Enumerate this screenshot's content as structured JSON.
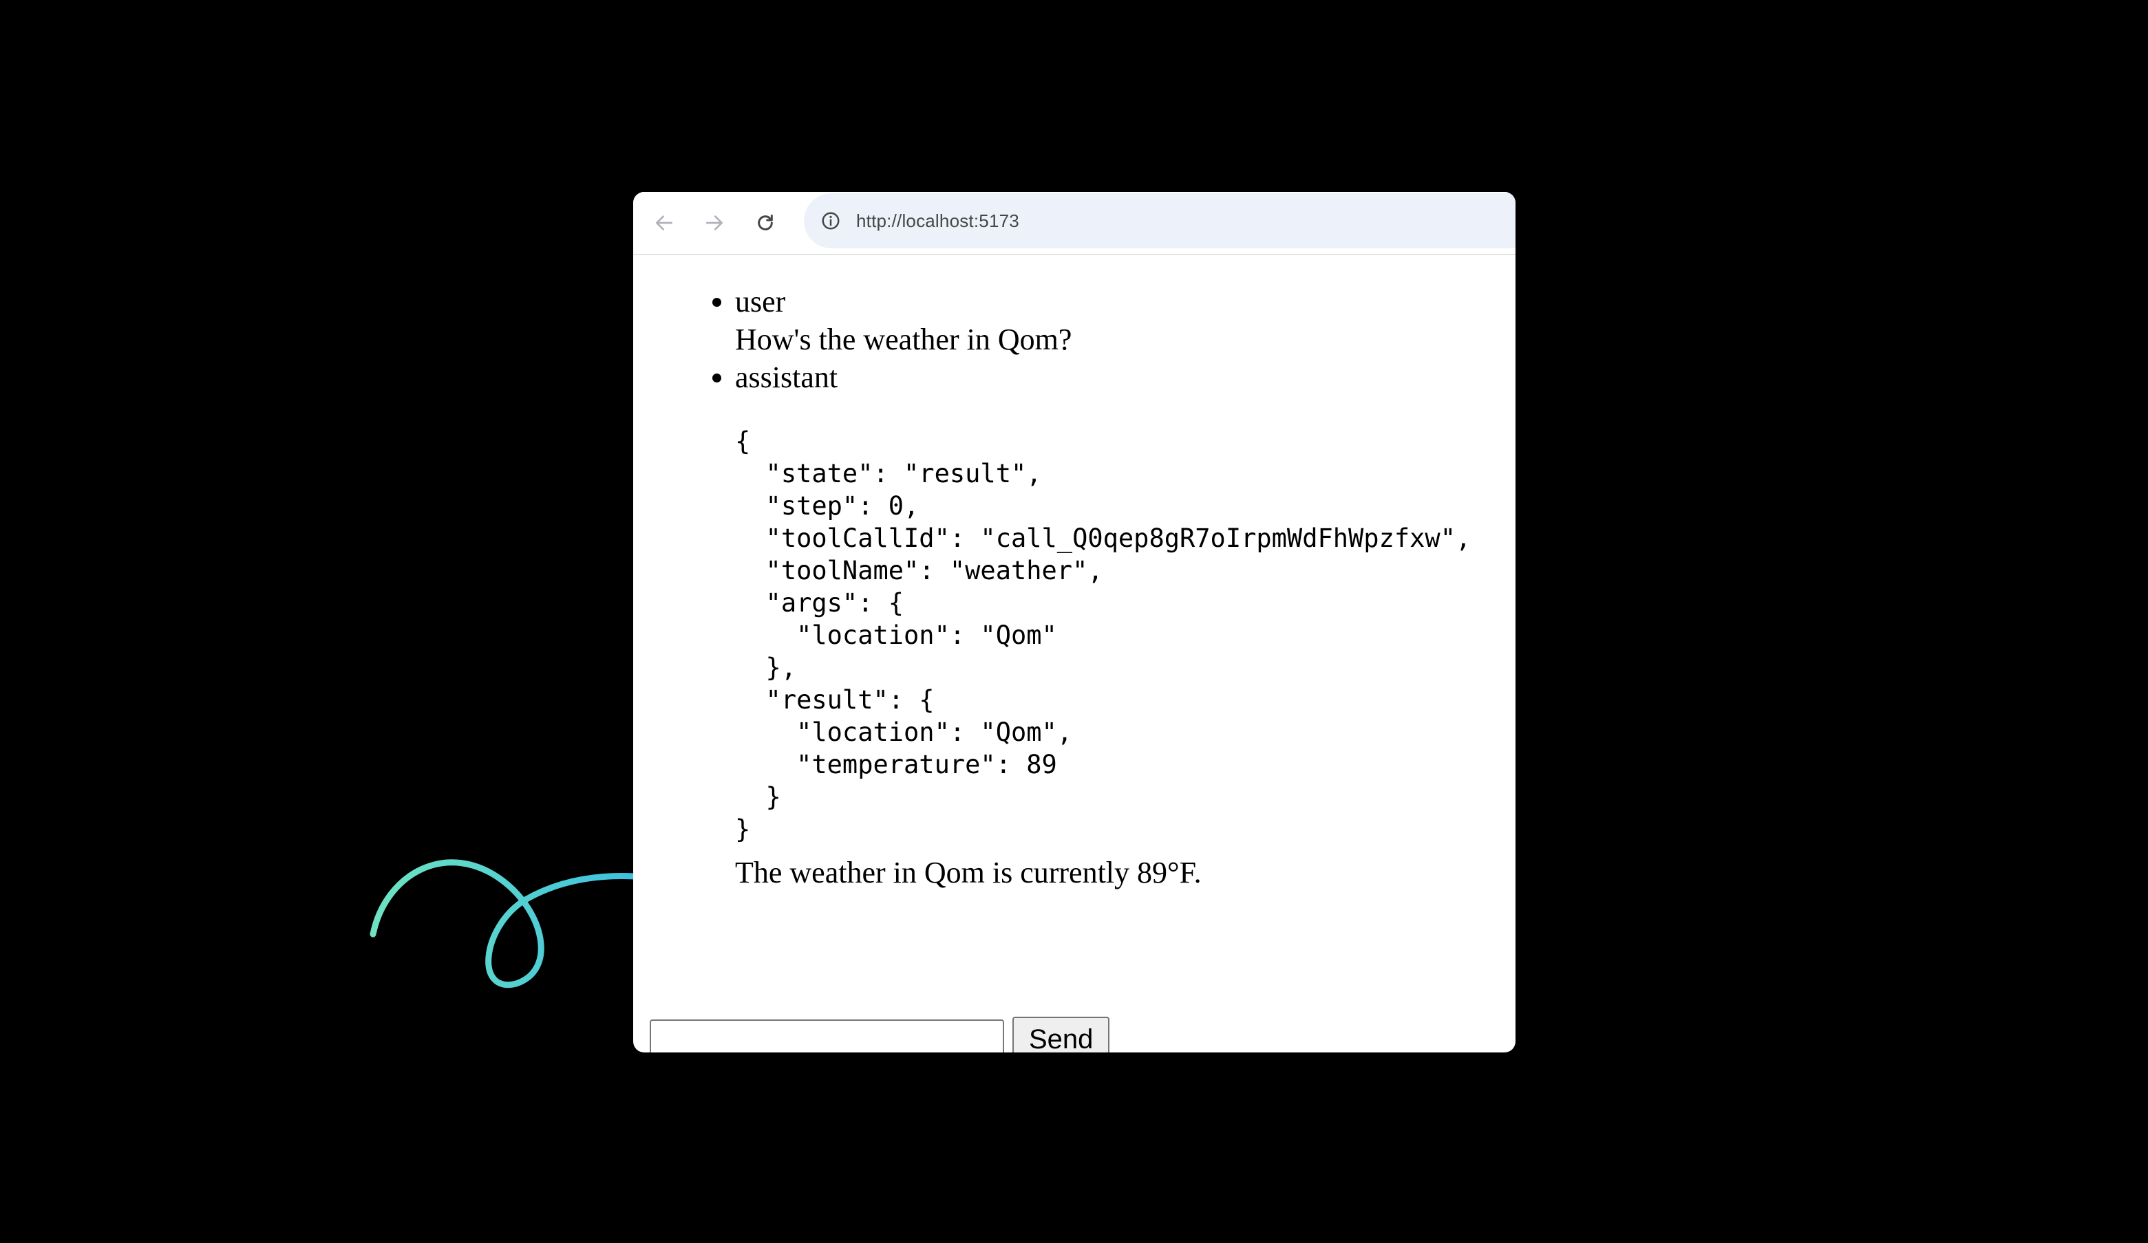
{
  "browser": {
    "url": "http://localhost:5173",
    "icons": {
      "back": "arrow-left-icon",
      "forward": "arrow-right-icon",
      "reload": "reload-icon",
      "site_info": "info-icon"
    }
  },
  "messages": [
    {
      "role": "user",
      "text": "How's the weather in Qom?"
    },
    {
      "role": "assistant",
      "tool_json": "{\n  \"state\": \"result\",\n  \"step\": 0,\n  \"toolCallId\": \"call_Q0qep8gR7oIrpmWdFhWpzfxw\",\n  \"toolName\": \"weather\",\n  \"args\": {\n    \"location\": \"Qom\"\n  },\n  \"result\": {\n    \"location\": \"Qom\",\n    \"temperature\": 89\n  }\n}",
      "text": "The weather in Qom is currently 89°F."
    }
  ],
  "composer": {
    "input_value": "",
    "send_label": "Send"
  },
  "colors": {
    "background": "#000000",
    "arrow_gradient_start": "#6fe3c1",
    "arrow_gradient_end": "#2fb6e8"
  }
}
